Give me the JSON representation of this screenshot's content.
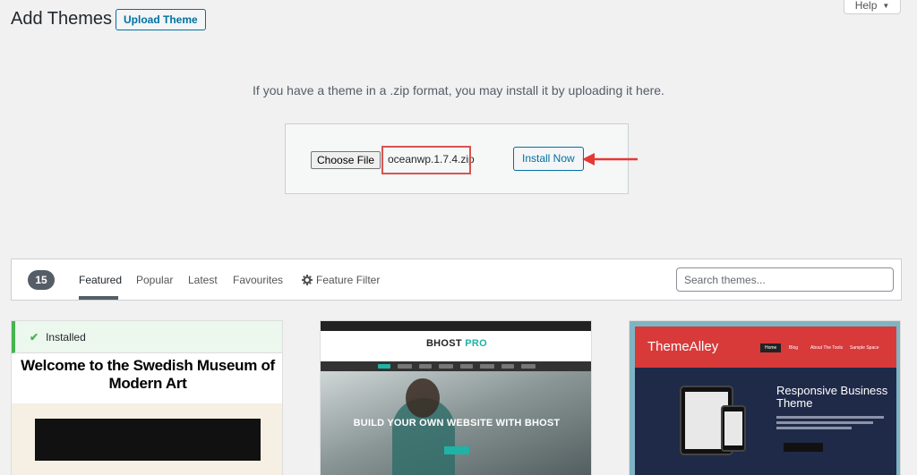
{
  "header": {
    "title": "Add Themes",
    "upload_label": "Upload Theme",
    "help_label": "Help"
  },
  "upload": {
    "description": "If you have a theme in a .zip format, you may install it by uploading it here.",
    "choose_file_label": "Choose File",
    "file_name": "oceanwp.1.7.4.zip",
    "install_label": "Install Now"
  },
  "filter": {
    "count": "15",
    "links": [
      "Featured",
      "Popular",
      "Latest",
      "Favourites"
    ],
    "active": "Featured",
    "feature_filter_label": "Feature Filter",
    "search_placeholder": "Search themes..."
  },
  "themes": [
    {
      "installed_label": "Installed",
      "headline": "Welcome to the Swedish Museum of Modern Art"
    },
    {
      "logo_main": "BHOST",
      "logo_accent": "PRO",
      "hero_text": "BUILD YOUR OWN WEBSITE WITH BHOST"
    },
    {
      "logo": "ThemeAlley",
      "nav": [
        "Home",
        "Blog",
        "About The Tools",
        "Sample Space"
      ],
      "hero_title": "Responsive Business Theme"
    }
  ],
  "colors": {
    "accent": "#0071a1",
    "highlight": "#d9534f",
    "installed_green": "#46b450"
  }
}
